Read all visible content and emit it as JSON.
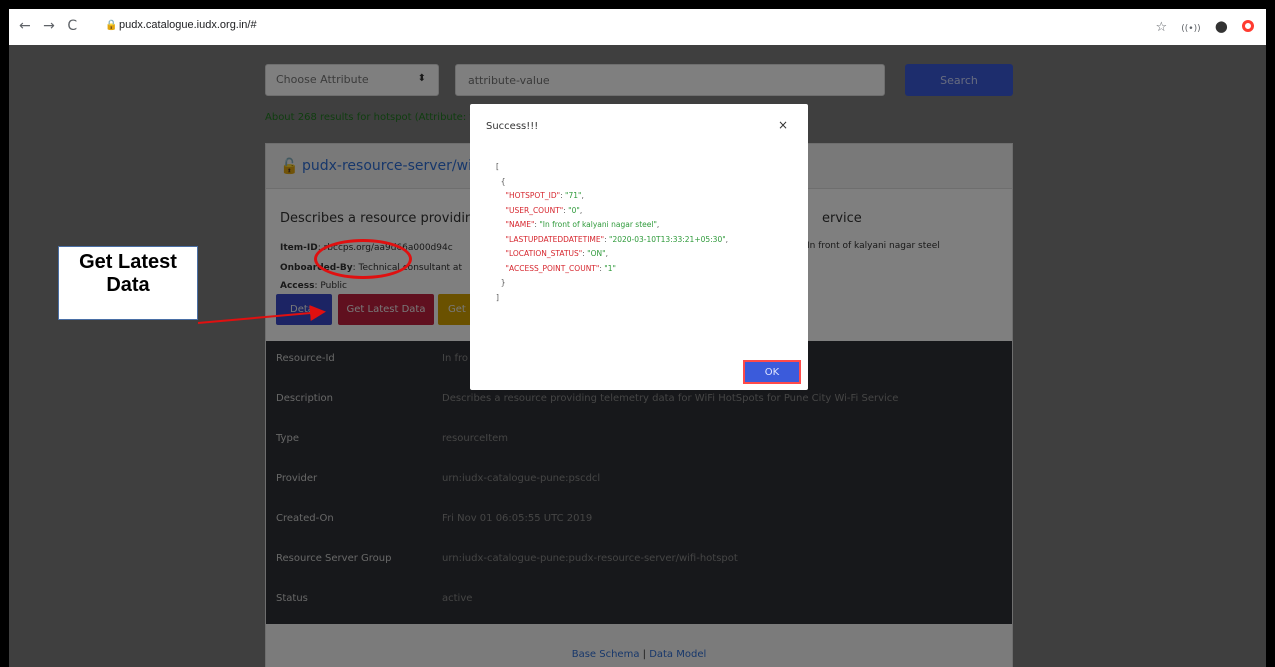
{
  "browser": {
    "url": "pudx.catalogue.iudx.org.in/#",
    "nav_glyphs": "← → C"
  },
  "search": {
    "attribute_placeholder": "Choose Attribute",
    "value_placeholder": "attribute-value",
    "button_label": "Search",
    "results_text": "About 268 results for hotspot (Attribute: to"
  },
  "card": {
    "title": "pudx-resource-server/wifi-",
    "description_left": "Describes a resource providing",
    "description_right": "ervice",
    "item_id_label": "Item-ID",
    "item_id_value": ": rbccps.org/aa9d66a000d94c",
    "item_id_right": "/In front of kalyani nagar steel",
    "onboarded_label": "Onboarded-By",
    "onboarded_value": ": Technical consultant at",
    "access_label": "Access",
    "access_value": ": Public",
    "buttons": {
      "details": "Deta",
      "latest": "Get Latest Data",
      "get": "Get"
    },
    "rows": [
      {
        "key": "Resource-Id",
        "value": "In fro"
      },
      {
        "key": "Description",
        "value": "Describes a resource providing telemetry data for WiFi HotSpots for Pune City Wi-Fi Service"
      },
      {
        "key": "Type",
        "value": "resourceItem"
      },
      {
        "key": "Provider",
        "value": "urn:iudx-catalogue-pune:pscdcl"
      },
      {
        "key": "Created-On",
        "value": "Fri Nov 01 06:05:55 UTC 2019"
      },
      {
        "key": "Resource Server Group",
        "value": "urn:iudx-catalogue-pune:pudx-resource-server/wifi-hotspot"
      },
      {
        "key": "Status",
        "value": "active"
      }
    ],
    "footer": {
      "base_schema": "Base Schema",
      "separator": " | ",
      "data_model": "Data Model"
    }
  },
  "modal": {
    "title": "Success!!!",
    "close": "×",
    "ok_label": "OK",
    "json": {
      "open_bracket": "[",
      "open_brace": "{",
      "close_brace": "}",
      "close_bracket": "]",
      "fields": [
        {
          "key": "\"HOTSPOT_ID\"",
          "value": "\"71\""
        },
        {
          "key": "\"USER_COUNT\"",
          "value": "\"0\""
        },
        {
          "key": "\"NAME\"",
          "value": "\"In front of kalyani nagar steel\""
        },
        {
          "key": "\"LASTUPDATEDDATETIME\"",
          "value": "\"2020-03-10T13:33:21+05:30\""
        },
        {
          "key": "\"LOCATION_STATUS\"",
          "value": "\"ON\""
        },
        {
          "key": "\"ACCESS_POINT_COUNT\"",
          "value": "\"1\""
        }
      ]
    }
  },
  "annotation": {
    "line1": "Get Latest",
    "line2": "Data"
  },
  "colors": {
    "primary": "#3b5bdb",
    "danger": "#c0203e",
    "warning": "#d4a200",
    "json_key": "#d6262e",
    "json_value": "#2e9a3a",
    "annotation_red": "#e01010"
  }
}
